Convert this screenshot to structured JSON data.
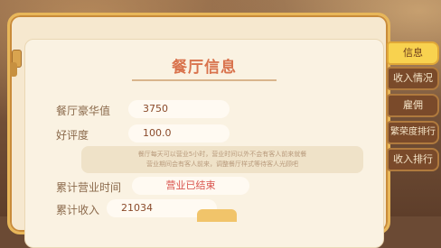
{
  "panel": {
    "title": "餐厅信息",
    "rows": [
      {
        "label": "餐厅豪华值",
        "value": "3750"
      },
      {
        "label": "好评度",
        "value": "100.0"
      }
    ],
    "note_line1": "餐厅每天可以营业5小时，营业时间以外不会有客人前来就餐",
    "note_line2": "营业期间会有客人前来，调整餐厅样式等待客人光顾吧",
    "accum_time_label": "累计营业时间",
    "accum_time_value": "营业已结束",
    "accum_income_label": "累计收入",
    "accum_income_value": "21034"
  },
  "tabs": [
    {
      "label": "信息",
      "active": true
    },
    {
      "label": "收入情况",
      "active": false
    },
    {
      "label": "雇佣",
      "active": false
    },
    {
      "label": "繁荣度排行",
      "active": false
    },
    {
      "label": "收入排行",
      "active": false
    }
  ]
}
